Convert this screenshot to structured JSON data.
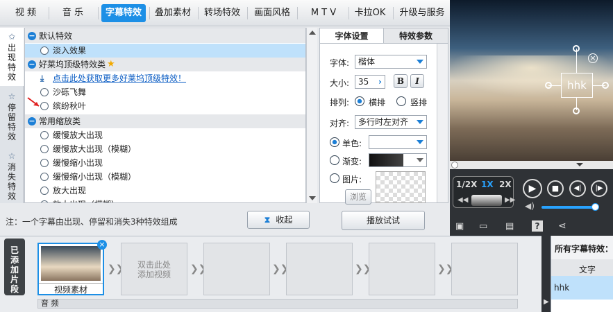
{
  "nav": {
    "tabs": [
      "视 频",
      "音 乐",
      "字幕特效",
      "叠加素材",
      "转场特效",
      "画面风格",
      "M T V",
      "卡拉OK",
      "升级与服务"
    ],
    "active": "字幕特效"
  },
  "vtabs": [
    "出现特效",
    "停留特效",
    "消失特效"
  ],
  "list": {
    "cat1": "默认特效",
    "item_fade": "淡入效果",
    "cat2": "好莱坞顶级特效类",
    "link": "点击此处获取更多好莱坞顶级特效！",
    "item_sand": "沙砾飞舞",
    "item_leaves": "缤纷秋叶",
    "cat3": "常用缩放类",
    "zoom": [
      "缓慢放大出现",
      "缓慢放大出现（模糊）",
      "缓慢缩小出现",
      "缓慢缩小出现（模糊）",
      "放大出现",
      "放大出现（模糊）"
    ]
  },
  "note": "注：一个字幕由出现、停留和消失3种特效组成",
  "collapse_btn": "收起",
  "right_tabs": [
    "字体设置",
    "特效参数"
  ],
  "font": {
    "font_label": "字体:",
    "font_value": "楷体",
    "size_label": "大小:",
    "size_value": "35",
    "bold": "B",
    "italic": "I",
    "layout_label": "排列:",
    "horizontal": "横排",
    "vertical": "竖排",
    "align_label": "对齐:",
    "align_value": "多行时左对齐",
    "solid_label": "单色:",
    "gradient_label": "渐变:",
    "image_label": "图片:",
    "browse": "浏览"
  },
  "play_btn": "播放试试",
  "preview": {
    "text": "hhk"
  },
  "speed": [
    "1/2X",
    "1X",
    "2X"
  ],
  "timeline": {
    "tab": "已添加片段",
    "clip_label": "视频素材",
    "add_hint": "双击此处添加视频",
    "audio_label": "音 频"
  },
  "right_panel": {
    "title": "所有字幕特效：",
    "col": "文字",
    "row1": "hhk"
  },
  "colors": {
    "accent": "#1c8fe6",
    "link": "#0a5cc4",
    "selected": "#bfe1fb"
  }
}
